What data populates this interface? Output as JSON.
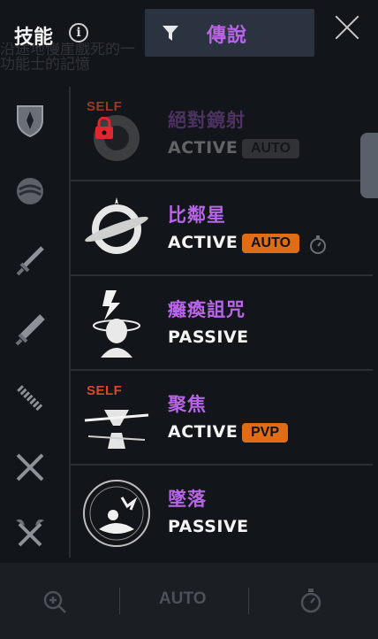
{
  "background": {
    "text_line1": "沿途地慢崖戲死的一",
    "text_line2": "功能士的記憶"
  },
  "header": {
    "title": "技能",
    "info_icon": "info-icon",
    "filter_label": "傳說",
    "filter_icon": "filter-icon",
    "close_icon": "close-icon"
  },
  "sidebar": {
    "icons": [
      "shield-icon",
      "orb-icon",
      "sword-icon",
      "greatsword-icon",
      "spiked-sword-icon",
      "crossed-swords-icon",
      "crossed-axes-icon"
    ]
  },
  "skills": [
    {
      "name": "絕對鏡射",
      "type": "ACTIVE",
      "badge": "AUTO",
      "self": "SELF",
      "locked": true
    },
    {
      "name": "比鄰星",
      "type": "ACTIVE",
      "badge": "AUTO",
      "timer": true
    },
    {
      "name": "癱瘓詛咒",
      "type": "PASSIVE"
    },
    {
      "name": "聚焦",
      "type": "ACTIVE",
      "badge": "PVP",
      "self": "SELF"
    },
    {
      "name": "墜落",
      "type": "PASSIVE"
    }
  ],
  "footer": {
    "zoom_icon": "zoom-in-icon",
    "auto_label": "AUTO",
    "timer_icon": "stopwatch-icon"
  },
  "colors": {
    "accent": "#b865e8",
    "badge": "#e06d16",
    "self": "#d64a28",
    "lock": "#e0262e"
  }
}
